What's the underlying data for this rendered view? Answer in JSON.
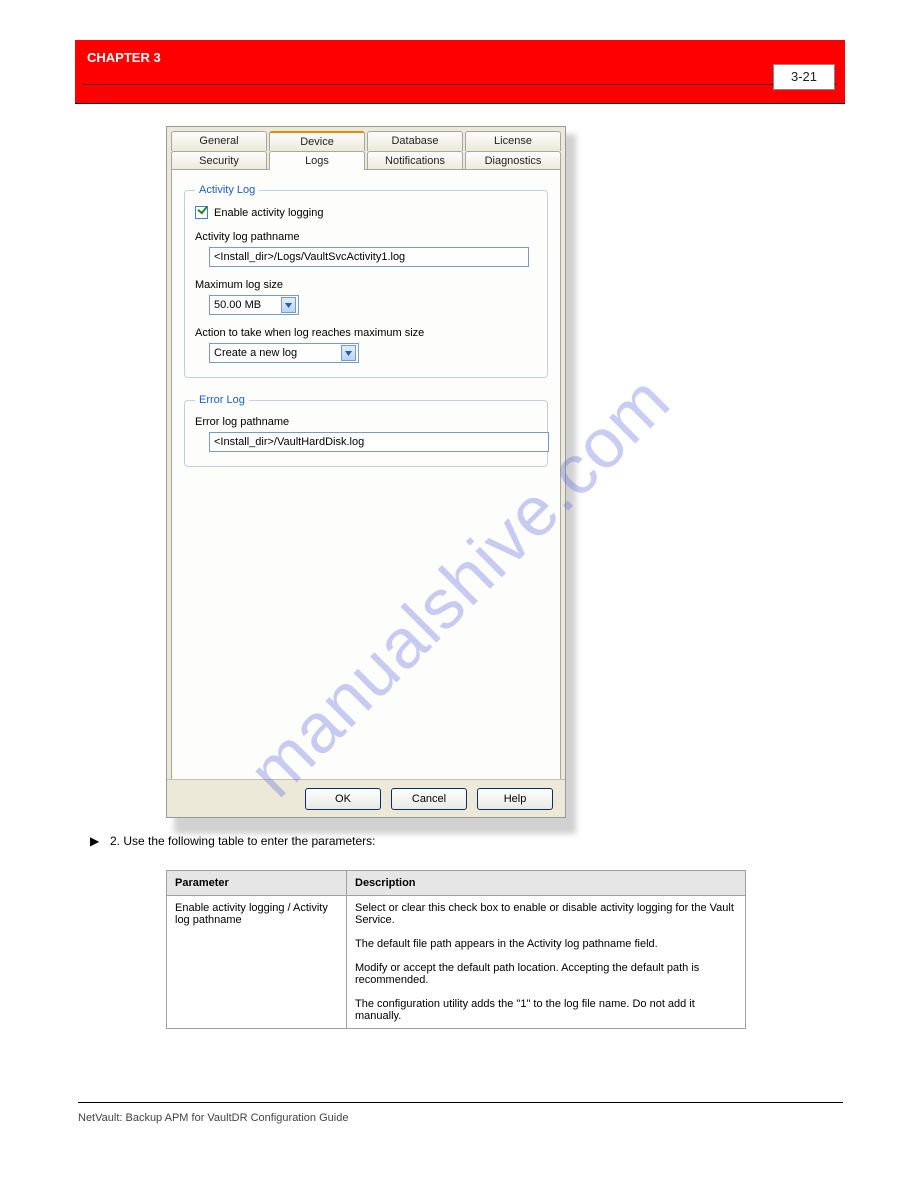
{
  "watermark": "manualshive.com",
  "header": {
    "chapter": "CHAPTER 3",
    "page": "3-21"
  },
  "dialog": {
    "tabs_row1": [
      "General",
      "Device",
      "Database",
      "License"
    ],
    "tabs_row2": [
      "Security",
      "Logs",
      "Notifications",
      "Diagnostics"
    ],
    "active_tab": "Logs",
    "activity_group": {
      "legend": "Activity Log",
      "enable_label": "Enable activity logging",
      "enable_checked": true,
      "pathname_label": "Activity log pathname",
      "pathname_value": "<Install_dir>/Logs/VaultSvcActivity1.log",
      "maxsize_label": "Maximum log size",
      "maxsize_value": "50.00 MB",
      "action_label": "Action to take when log reaches maximum size",
      "action_value": "Create a new log"
    },
    "error_group": {
      "legend": "Error Log",
      "pathname_label": "Error log pathname",
      "pathname_value": "<Install_dir>/VaultHardDisk.log"
    },
    "buttons": {
      "ok": "OK",
      "cancel": "Cancel",
      "help": "Help"
    }
  },
  "step": {
    "number": "2.",
    "text": "Use the following table to enter the parameters:"
  },
  "table": {
    "headers": [
      "Parameter",
      "Description"
    ],
    "row": {
      "param": "Enable activity logging / Activity log pathname",
      "desc": "Select or clear this check box to enable or disable activity logging for the Vault Service.\n\nThe default file path appears in the Activity log pathname field.\n\nModify or accept the default path location. Accepting the default path is recommended.\n\nThe configuration utility adds the \"1\" to the log file name. Do not add it manually."
    }
  },
  "footer": {
    "left": "NetVault: Backup APM for VaultDR Configuration Guide",
    "right": ""
  }
}
